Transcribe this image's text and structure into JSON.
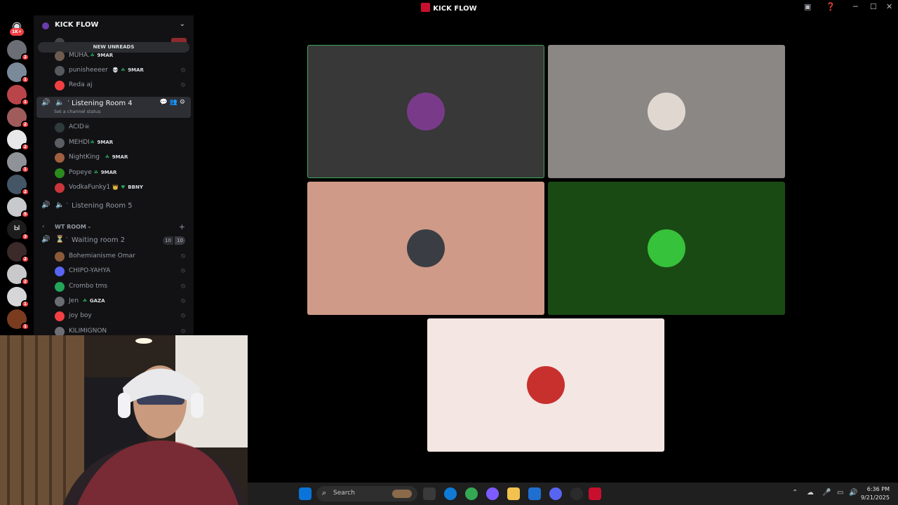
{
  "window": {
    "title": "KICK FLOW"
  },
  "server_list": {
    "home_badge": "1K+",
    "servers": [
      {
        "badge": "2",
        "color": "#6b6e74"
      },
      {
        "badge": "1",
        "color": "#7a8a9a"
      },
      {
        "badge": "1",
        "color": "#b9454a"
      },
      {
        "badge": "2",
        "color": "#a05b5b"
      },
      {
        "badge": "2",
        "color": "#e8e8ea"
      },
      {
        "badge": "1",
        "color": "#8f9296"
      },
      {
        "badge": "2",
        "color": "#445566"
      },
      {
        "badge": "5",
        "color": "#c7c9cc"
      },
      {
        "badge": "3",
        "color": "#1c1c1c",
        "label": "Ы"
      },
      {
        "badge": "2",
        "color": "#3a2a2a"
      },
      {
        "badge": "2",
        "color": "#c9c9cb"
      },
      {
        "badge": "1",
        "color": "#d6d6d8"
      },
      {
        "badge": "1",
        "color": "#7a3b1f"
      }
    ]
  },
  "guild": {
    "name": "KICK FLOW",
    "new_unreads": "NEW UNREADS",
    "top_members": [
      {
        "name": "MUHA.",
        "tag": "9MAR",
        "tag_icon": "☘",
        "avatar_color": "#6d5c4f",
        "muted": false
      },
      {
        "name": "punisheeeer",
        "emoji": "💀",
        "tag": "9MAR",
        "tag_icon": "☘",
        "avatar_color": "#56595e",
        "muted": true
      },
      {
        "name": "Reda aj",
        "tag": "",
        "avatar_color": "#f23f43",
        "muted": true
      }
    ],
    "listening_room_4": {
      "name": "Listening Room 4",
      "status": "Set a channel status",
      "members": [
        {
          "name": "ACID☠",
          "tag": "",
          "avatar_color": "#2f3b3a"
        },
        {
          "name": "MEHDI",
          "tag": "9MAR",
          "tag_icon": "☘",
          "avatar_color": "#5b5e63"
        },
        {
          "name": "NightKing",
          "tag": "9MAR",
          "tag_icon": "☘",
          "avatar_color": "#a0603f"
        },
        {
          "name": "Popeye",
          "tag": "9MAR",
          "tag_icon": "☘",
          "avatar_color": "#2d8a1e"
        },
        {
          "name": "VodkaFunky1",
          "emoji": "👑",
          "tag": "BBNY",
          "tag_icon": "♥",
          "avatar_color": "#c9353a"
        }
      ]
    },
    "listening_room_5": {
      "name": "Listening Room 5"
    },
    "category": {
      "name": "WT ROOM"
    },
    "waiting_room": {
      "name": "Waiting room 2",
      "count_left": "10",
      "count_right": "10",
      "members": [
        {
          "name": "Bohemianisme Omar",
          "tag": "",
          "avatar_color": "#8a5a3a"
        },
        {
          "name": "CHIPO-YAHYA",
          "tag": "",
          "avatar_color": "#5865f2"
        },
        {
          "name": "Crombo tms",
          "tag": "",
          "avatar_color": "#23a55a"
        },
        {
          "name": "Jen",
          "tag": "GAZA",
          "tag_icon": "☘",
          "avatar_color": "#6a6d72"
        },
        {
          "name": "joy boy",
          "tag": "",
          "avatar_color": "#f23f43"
        },
        {
          "name": "KILIMIGNON",
          "tag": "",
          "avatar_color": "#6d6f74"
        }
      ]
    }
  },
  "stage": {
    "tiles": [
      {
        "bg": "#373837",
        "border": "#3ba55c",
        "avatar_color": "#7a3a8a"
      },
      {
        "bg": "#8a8785",
        "border": "",
        "avatar_color": "#e0d8d0"
      },
      {
        "bg": "#cf9a88",
        "border": "",
        "avatar_color": "#3a3e44"
      },
      {
        "bg": "#1a4a14",
        "border": "",
        "avatar_color": "#36c23a"
      },
      {
        "bg": "#f3e6e3",
        "border": "",
        "avatar_color": "#c8302e"
      }
    ]
  },
  "taskbar": {
    "search_label": "Search",
    "time": "6:36 PM",
    "date": "9/21/2025"
  }
}
